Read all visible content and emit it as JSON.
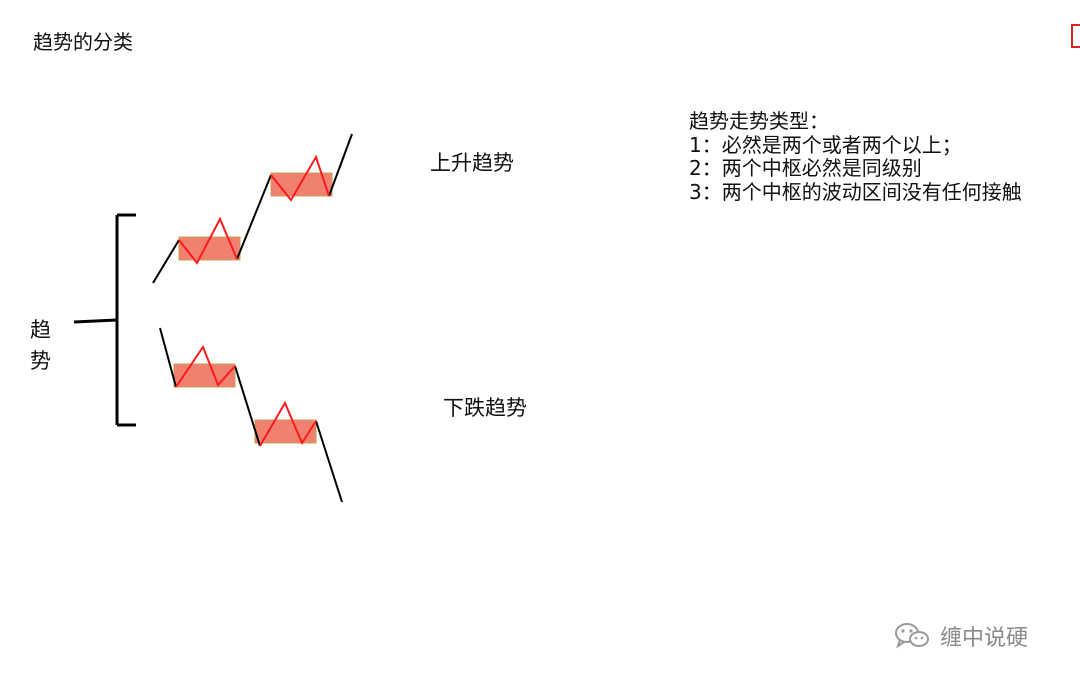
{
  "title": "趋势的分类",
  "side_label": [
    "趋",
    "势"
  ],
  "labels": {
    "up": "上升趋势",
    "down": "下跌趋势"
  },
  "notes": {
    "heading": "趋势走势类型：",
    "items": [
      "1：必然是两个或者两个以上；",
      "2：两个中枢必然是同级别",
      "3：两个中枢的波动区间没有任何接触"
    ]
  },
  "watermark": {
    "text": "缠中说硬",
    "icon": "wechat-icon"
  },
  "colors": {
    "box_fill": "#f08070",
    "box_border": "#c9a050",
    "zigzag": "#ff1a1a",
    "trend_line": "#000000",
    "corner_mark": "#d82020"
  }
}
